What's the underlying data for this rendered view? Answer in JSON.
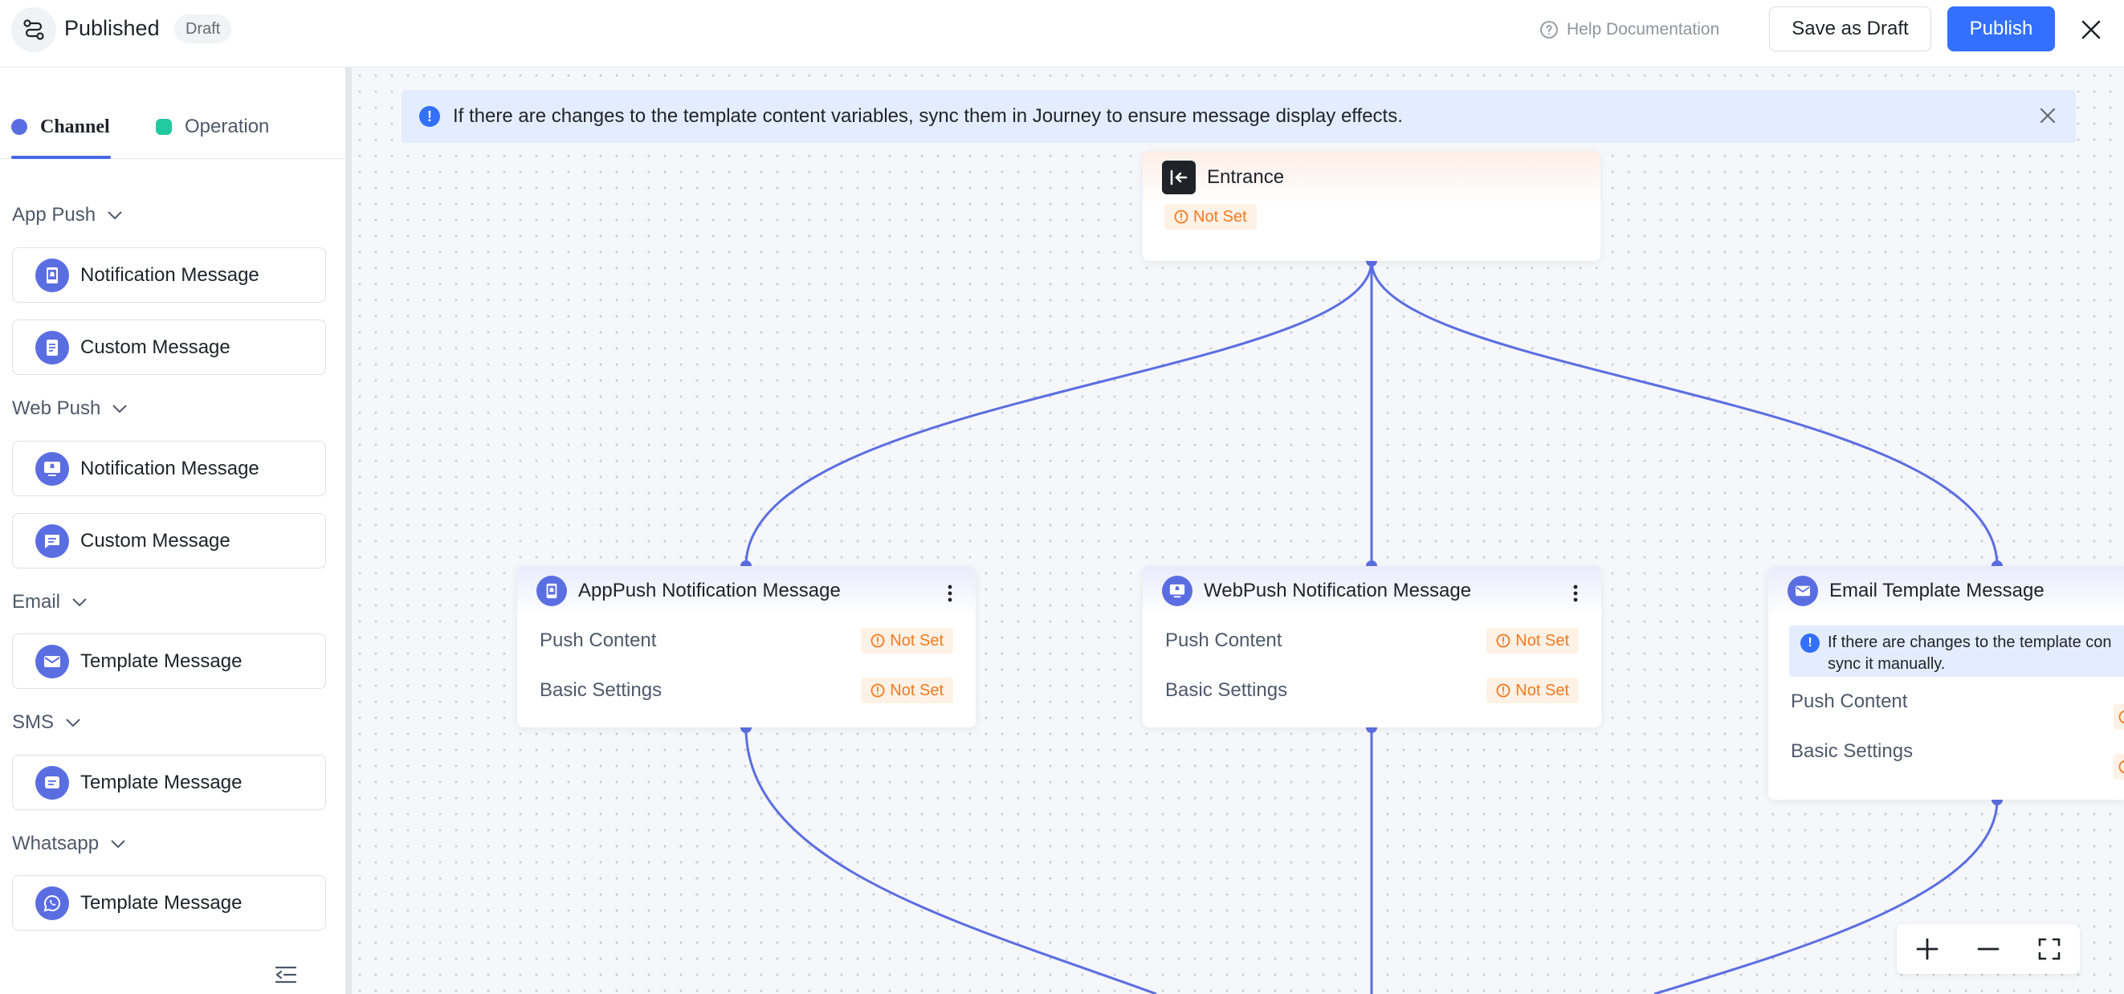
{
  "header": {
    "title": "Published",
    "status_badge": "Draft",
    "help_label": "Help Documentation",
    "save_draft_label": "Save as Draft",
    "publish_label": "Publish"
  },
  "sidebar": {
    "tabs": [
      {
        "label": "Channel",
        "active": true,
        "dot_color": "#5b6ee1"
      },
      {
        "label": "Operation",
        "active": false,
        "dot_color": "#23c9a0"
      }
    ],
    "groups": [
      {
        "label": "App Push",
        "items": [
          {
            "label": "Notification Message",
            "icon": "app-notification-icon"
          },
          {
            "label": "Custom Message",
            "icon": "custom-message-icon"
          }
        ]
      },
      {
        "label": "Web Push",
        "items": [
          {
            "label": "Notification Message",
            "icon": "web-notification-icon"
          },
          {
            "label": "Custom Message",
            "icon": "chat-message-icon"
          }
        ]
      },
      {
        "label": "Email",
        "items": [
          {
            "label": "Template Message",
            "icon": "mail-icon"
          }
        ]
      },
      {
        "label": "SMS",
        "items": [
          {
            "label": "Template Message",
            "icon": "sms-icon"
          }
        ]
      },
      {
        "label": "Whatsapp",
        "items": [
          {
            "label": "Template Message",
            "icon": "whatsapp-icon"
          }
        ]
      }
    ]
  },
  "canvas": {
    "banner_text": "If there are changes to the template content variables, sync them in Journey to ensure message display effects.",
    "nodes": {
      "entrance": {
        "title": "Entrance",
        "status": "Not Set"
      },
      "app_push": {
        "title": "AppPush Notification Message",
        "rows": [
          {
            "label": "Push Content",
            "status": "Not Set"
          },
          {
            "label": "Basic Settings",
            "status": "Not Set"
          }
        ]
      },
      "web_push": {
        "title": "WebPush Notification Message",
        "rows": [
          {
            "label": "Push Content",
            "status": "Not Set"
          },
          {
            "label": "Basic Settings",
            "status": "Not Set"
          }
        ]
      },
      "email": {
        "title": "Email Template Message",
        "alert_line1": "If there are changes to the template con",
        "alert_line2": "sync it manually.",
        "rows": [
          {
            "label": "Push Content",
            "status": "Not Set"
          },
          {
            "label": "Basic Settings",
            "status": "Not Set"
          }
        ]
      }
    }
  },
  "colors": {
    "accent": "#3370ff",
    "connector": "#5b6ee1",
    "warning": "#f07b1f"
  }
}
